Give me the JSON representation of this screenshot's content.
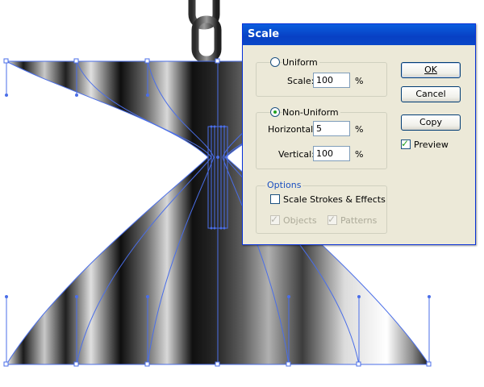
{
  "dialog": {
    "title": "Scale",
    "uniform": {
      "label": "Uniform",
      "selected": false,
      "scale_label": "Scale:",
      "scale_value": "100",
      "unit": "%"
    },
    "non_uniform": {
      "label": "Non-Uniform",
      "selected": true,
      "horizontal_label": "Horizontal:",
      "horizontal_value": "5",
      "vertical_label": "Vertical:",
      "vertical_value": "100",
      "unit": "%"
    },
    "options": {
      "title": "Options",
      "scale_strokes_label": "Scale Strokes & Effects",
      "scale_strokes_checked": false,
      "objects_label": "Objects",
      "objects_checked": true,
      "objects_enabled": false,
      "patterns_label": "Patterns",
      "patterns_checked": true,
      "patterns_enabled": false
    },
    "buttons": {
      "ok": "OK",
      "cancel": "Cancel",
      "copy": "Copy"
    },
    "preview": {
      "label": "Preview",
      "checked": true
    }
  },
  "colors": {
    "selection": "#4a6ee8",
    "titlebar": "#0a4fd6",
    "dialog_bg": "#ece9d8"
  },
  "icons": {
    "check": "✓"
  }
}
